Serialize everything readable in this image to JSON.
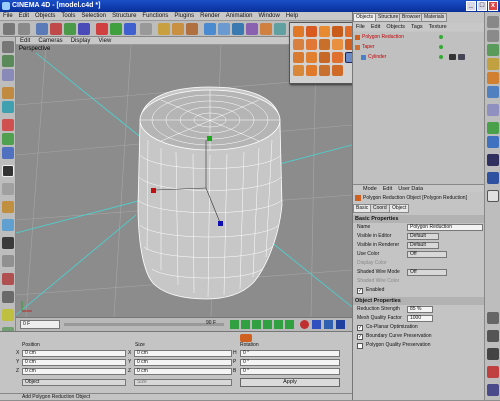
{
  "window": {
    "title": "CINEMA 4D - [model.c4d *]"
  },
  "menu": [
    "File",
    "Edit",
    "Objects",
    "Tools",
    "Selection",
    "Structure",
    "Functions",
    "Plugins",
    "Render",
    "Animation",
    "Window",
    "Help"
  ],
  "viewport": {
    "menu": [
      "Edit",
      "Cameras",
      "Display",
      "View"
    ],
    "label": "Perspective"
  },
  "timeline": {
    "start": "0 F",
    "end": "90 F"
  },
  "coords": {
    "headers": [
      "Position",
      "Size",
      "Rotation"
    ],
    "rows": [
      {
        "axis": "X",
        "pos": "0 cm",
        "size": "0 cm",
        "rot_axis": "H",
        "rot": "0 °"
      },
      {
        "axis": "Y",
        "pos": "0 cm",
        "size": "0 cm",
        "rot_axis": "P",
        "rot": "0 °"
      },
      {
        "axis": "Z",
        "pos": "0 cm",
        "size": "0 cm",
        "rot_axis": "B",
        "rot": "0 °"
      }
    ],
    "mode": "Object",
    "size_mode": "Size",
    "apply": "Apply"
  },
  "status": "Add Polygon Reduction Object",
  "object_manager": {
    "tabs": [
      "Objects",
      "Structure",
      "Browser",
      "Materials"
    ],
    "menu": [
      "File",
      "Edit",
      "Objects",
      "Tags",
      "Texture"
    ],
    "items": [
      {
        "name": "Polygon Reduction",
        "color": "#c00000"
      },
      {
        "name": "Taper",
        "color": "#c00000"
      },
      {
        "name": "Cylinder",
        "color": "#c00000"
      }
    ]
  },
  "attributes": {
    "menu": [
      "Mode",
      "Edit",
      "User Data"
    ],
    "title": "Polygon Reduction Object [Polygon Reduction]",
    "tabs": [
      "Basic",
      "Coord",
      "Object"
    ],
    "basic_header": "Basic Properties",
    "basic": [
      {
        "label": "Name",
        "value": "Polygon Reduction"
      },
      {
        "label": "Visible in Editor",
        "value": "Default"
      },
      {
        "label": "Visible in Renderer",
        "value": "Default"
      },
      {
        "label": "Use Color",
        "value": "Off"
      },
      {
        "label": "Display Color",
        "value": ""
      },
      {
        "label": "Shaded Wire Mode",
        "value": "Off"
      },
      {
        "label": "Shaded Wire Color",
        "value": ""
      }
    ],
    "enabled_label": "Enabled",
    "object_header": "Object Properties",
    "object": [
      {
        "label": "Reduction Strength",
        "value": "85 %"
      },
      {
        "label": "Mesh Quality Factor",
        "value": "1000"
      }
    ],
    "checks": [
      {
        "label": "Co-Planar Optimization",
        "checked": true
      },
      {
        "label": "Boundary Curve Preservation",
        "checked": true
      },
      {
        "label": "Polygon Quality Preservation",
        "checked": false
      }
    ]
  }
}
